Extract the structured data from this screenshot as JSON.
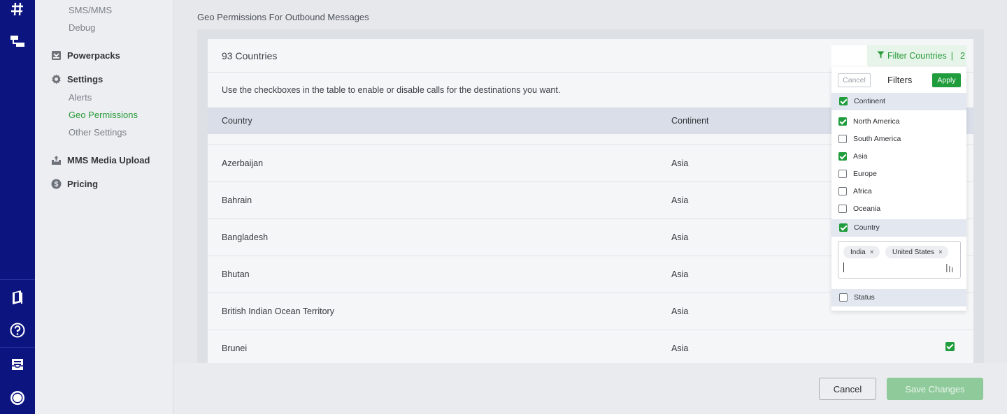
{
  "sidebar": {
    "sub_top": [
      "SMS/MMS",
      "Debug"
    ],
    "powerpacks": "Powerpacks",
    "settings": "Settings",
    "settings_items": [
      "Alerts",
      "Geo Permissions",
      "Other Settings"
    ],
    "mms_upload": "MMS Media Upload",
    "pricing": "Pricing"
  },
  "main": {
    "section_title": "Geo Permissions For Outbound Messages",
    "count_label": "93 Countries",
    "instructions": "Use the checkboxes in the table to enable or disable calls for the destinations you want.",
    "columns": [
      "Country",
      "Continent"
    ],
    "rows": [
      {
        "country": "Azerbaijan",
        "continent": "Asia"
      },
      {
        "country": "Bahrain",
        "continent": "Asia"
      },
      {
        "country": "Bangladesh",
        "continent": "Asia"
      },
      {
        "country": "Bhutan",
        "continent": "Asia"
      },
      {
        "country": "British Indian Ocean Territory",
        "continent": "Asia"
      },
      {
        "country": "Brunei",
        "continent": "Asia"
      }
    ]
  },
  "filter": {
    "button_label": "Filter Countries",
    "button_count": "2",
    "cancel": "Cancel",
    "title": "Filters",
    "apply": "Apply",
    "continent_label": "Continent",
    "continents": [
      {
        "label": "North America",
        "checked": true
      },
      {
        "label": "South America",
        "checked": false
      },
      {
        "label": "Asia",
        "checked": true
      },
      {
        "label": "Europe",
        "checked": false
      },
      {
        "label": "Africa",
        "checked": false
      },
      {
        "label": "Oceania",
        "checked": false
      }
    ],
    "country_label": "Country",
    "country_tags": [
      "India",
      "United States"
    ],
    "status_label": "Status"
  },
  "footer": {
    "cancel": "Cancel",
    "save": "Save Changes"
  },
  "colors": {
    "rail": "#0c1480",
    "accent_green": "#1f9c3c",
    "active_link": "#2a9b3b"
  },
  "icons": {
    "rail": [
      "hash-icon",
      "flow-icon",
      "docs-icon",
      "help-icon",
      "inbox-icon",
      "account-icon"
    ],
    "sidebar": [
      "powerpacks-icon",
      "gear-icon",
      "upload-icon",
      "dollar-icon"
    ]
  }
}
